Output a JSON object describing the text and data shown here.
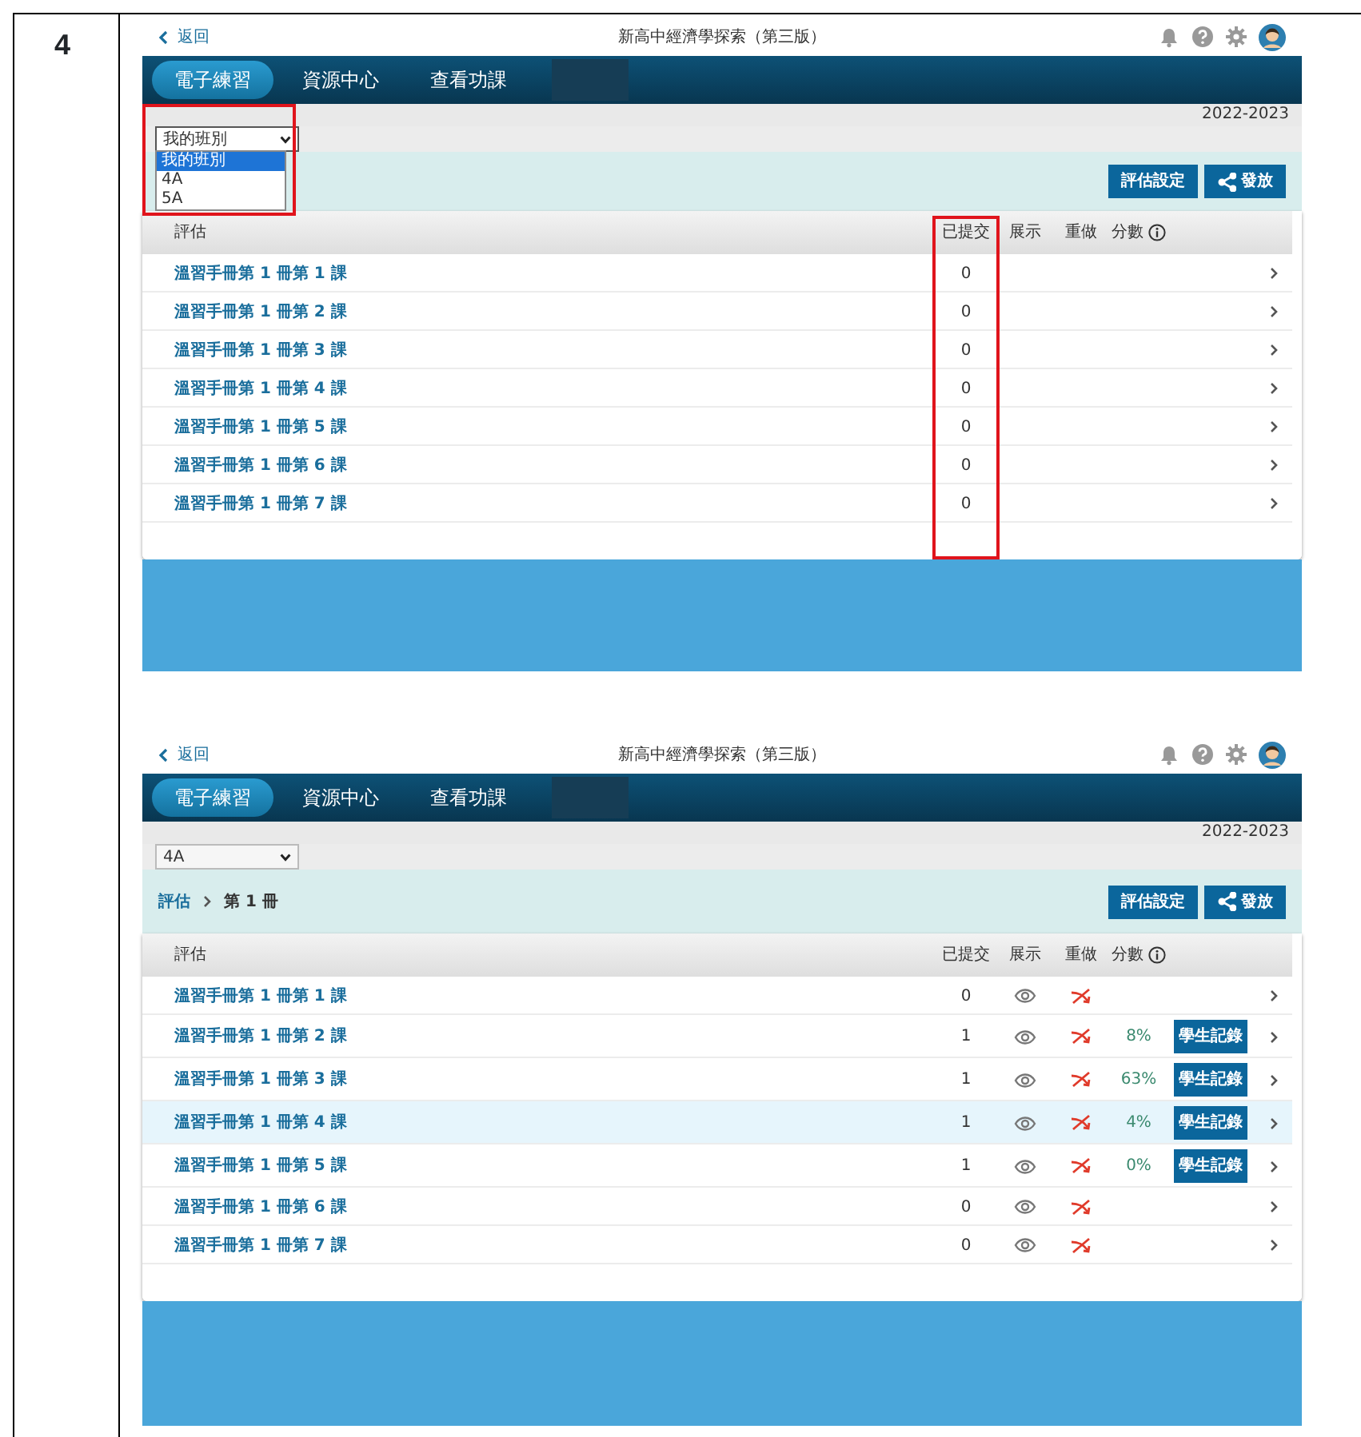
{
  "step": "4",
  "screens": [
    {
      "header": {
        "back": "返回",
        "title": "新高中經濟學探索（第三版）"
      },
      "tabs": [
        {
          "label": "電子練習",
          "selected": true
        },
        {
          "label": "資源中心",
          "selected": false
        },
        {
          "label": "查看功課",
          "selected": false
        }
      ],
      "year": "2022-2023",
      "class_select": {
        "value": "我的班別",
        "highlighted": true,
        "expanded": true,
        "options": [
          {
            "label": "我的班別",
            "selected": true
          },
          {
            "label": "4A",
            "selected": false
          },
          {
            "label": "5A",
            "selected": false
          }
        ]
      },
      "buttons": [
        "評估設定",
        "發放"
      ],
      "table": {
        "columns": [
          {
            "label": "評估"
          },
          {
            "label": "已提交",
            "highlighted": true
          },
          {
            "label": "展示"
          },
          {
            "label": "重做"
          },
          {
            "label": "分數",
            "info": true
          }
        ],
        "rows": [
          {
            "title": "溫習手冊第 1 冊第 1 課",
            "submitted": "0",
            "selected": false
          },
          {
            "title": "溫習手冊第 1 冊第 2 課",
            "submitted": "0",
            "selected": false
          },
          {
            "title": "溫習手冊第 1 冊第 3 課",
            "submitted": "0",
            "selected": false
          },
          {
            "title": "溫習手冊第 1 冊第 4 課",
            "submitted": "0",
            "selected": false
          },
          {
            "title": "溫習手冊第 1 冊第 5 課",
            "submitted": "0",
            "selected": false
          },
          {
            "title": "溫習手冊第 1 冊第 6 課",
            "submitted": "0",
            "selected": false
          },
          {
            "title": "溫習手冊第 1 冊第 7 課",
            "submitted": "0",
            "selected": false
          }
        ]
      }
    },
    {
      "header": {
        "back": "返回",
        "title": "新高中經濟學探索（第三版）"
      },
      "tabs": [
        {
          "label": "電子練習",
          "selected": true
        },
        {
          "label": "資源中心",
          "selected": false
        },
        {
          "label": "查看功課",
          "selected": false
        }
      ],
      "year": "2022-2023",
      "class_select": {
        "value": "4A",
        "expanded": false
      },
      "breadcrumb": [
        {
          "label": "評估",
          "link": true
        },
        {
          "label": "第 1 冊",
          "link": false
        }
      ],
      "buttons": [
        "評估設定",
        "發放"
      ],
      "table": {
        "columns": [
          {
            "label": "評估"
          },
          {
            "label": "已提交"
          },
          {
            "label": "展示"
          },
          {
            "label": "重做"
          },
          {
            "label": "分數",
            "info": true
          }
        ],
        "rows": [
          {
            "title": "溫習手冊第 1 冊第 1 課",
            "submitted": "0",
            "visible": true,
            "redo": false,
            "selected": false
          },
          {
            "title": "溫習手冊第 1 冊第 2 課",
            "submitted": "1",
            "visible": true,
            "redo": false,
            "score": "8%",
            "records_button": "學生記錄",
            "selected": false
          },
          {
            "title": "溫習手冊第 1 冊第 3 課",
            "submitted": "1",
            "visible": true,
            "redo": false,
            "score": "63%",
            "records_button": "學生記錄",
            "selected": false
          },
          {
            "title": "溫習手冊第 1 冊第 4 課",
            "submitted": "1",
            "visible": true,
            "redo": false,
            "score": "4%",
            "records_button": "學生記錄",
            "selected": true
          },
          {
            "title": "溫習手冊第 1 冊第 5 課",
            "submitted": "1",
            "visible": true,
            "redo": false,
            "score": "0%",
            "records_button": "學生記錄",
            "selected": false
          },
          {
            "title": "溫習手冊第 1 冊第 6 課",
            "submitted": "0",
            "visible": true,
            "redo": false,
            "selected": false
          },
          {
            "title": "溫習手冊第 1 冊第 7 課",
            "submitted": "0",
            "visible": true,
            "redo": false,
            "selected": false
          }
        ]
      }
    }
  ]
}
